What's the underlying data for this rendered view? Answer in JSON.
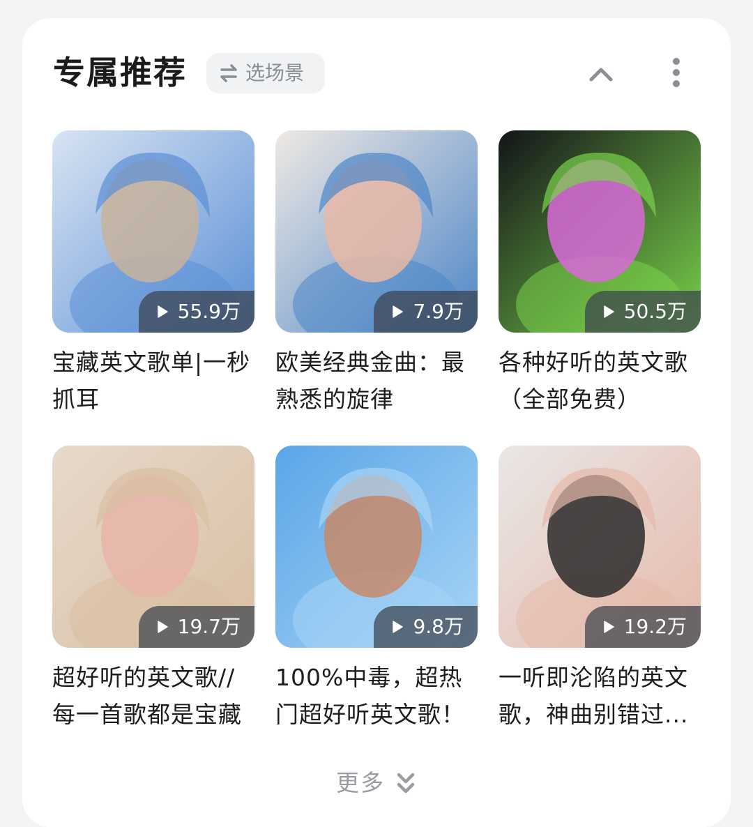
{
  "section": {
    "title": "专属推荐",
    "scene_button_label": "选场景",
    "scene_icon": "swap-arrows-icon",
    "collapse_icon": "chevron-up-icon",
    "more_options_icon": "vertical-dots-icon"
  },
  "playlists": [
    {
      "title": "宝藏英文歌单|一秒抓耳",
      "play_count": "55.9万",
      "colors": [
        "#d8e4f2",
        "#5b8fd6",
        "#c7b39b"
      ]
    },
    {
      "title": "欧美经典金曲：最熟悉的旋律",
      "play_count": "7.9万",
      "colors": [
        "#efe9e4",
        "#4d86c7",
        "#e9b9a6"
      ]
    },
    {
      "title": "各种好听的英文歌（全部免费）",
      "play_count": "50.5万",
      "colors": [
        "#121418",
        "#7ad14b",
        "#d86ad8"
      ]
    },
    {
      "title": "超好听的英文歌//每一首歌都是宝藏",
      "play_count": "19.7万",
      "colors": [
        "#e7d9cc",
        "#d9bfa2",
        "#e8b5a9"
      ]
    },
    {
      "title": "100%中毒，超热门超好听英文歌！",
      "play_count": "9.8万",
      "colors": [
        "#5aa6e8",
        "#a8d4f5",
        "#c78a68"
      ]
    },
    {
      "title": "一听即沦陷的英文歌，神曲别错过...",
      "play_count": "19.2万",
      "colors": [
        "#e9e7e6",
        "#e6b9aa",
        "#2a2a2a"
      ]
    }
  ],
  "footer": {
    "more_label": "更多",
    "more_icon": "double-chevron-down-icon"
  }
}
